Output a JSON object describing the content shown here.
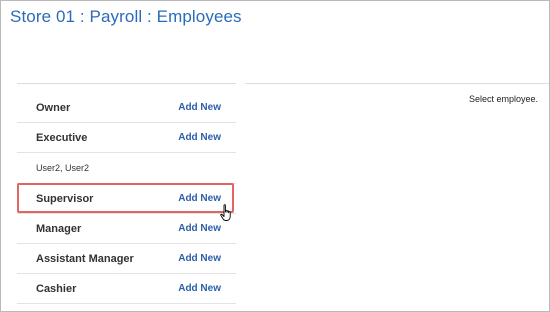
{
  "header": {
    "title": "Store 01 : Payroll : Employees"
  },
  "details": {
    "message": "Select employee."
  },
  "roles": [
    {
      "name": "Owner",
      "action": "Add New"
    },
    {
      "name": "Executive",
      "action": "Add New",
      "members": [
        "User2, User2"
      ]
    },
    {
      "name": "Supervisor",
      "action": "Add New",
      "highlighted": true
    },
    {
      "name": "Manager",
      "action": "Add New"
    },
    {
      "name": "Assistant Manager",
      "action": "Add New"
    },
    {
      "name": "Cashier",
      "action": "Add New"
    }
  ],
  "colors": {
    "title": "#2b6cb8",
    "link": "#2b5fab",
    "highlight_border": "#e06666"
  }
}
